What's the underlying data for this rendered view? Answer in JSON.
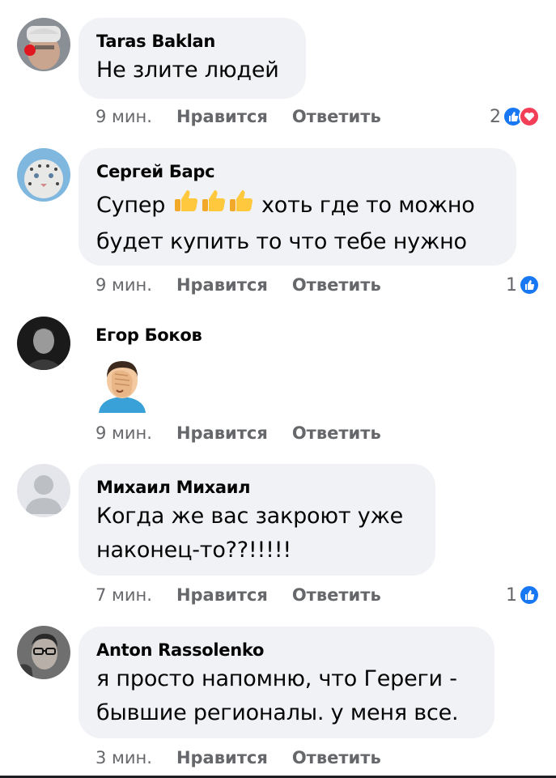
{
  "comments": [
    {
      "author": "Taras Baklan",
      "lines": [
        "Не злите людей"
      ],
      "time": "9 мин.",
      "like_label": "Нравится",
      "reply_label": "Ответить",
      "reaction_count": "2",
      "reactions": [
        "like-icon",
        "love-icon"
      ]
    },
    {
      "author": "Сергей Барс",
      "line1_before": "Супер",
      "line1_after": "хоть где то можно",
      "line2": "будет купить то что тебе нужно",
      "emoji": [
        "thumbs-up-icon",
        "thumbs-up-icon",
        "thumbs-up-icon"
      ],
      "time": "9 мин.",
      "like_label": "Нравится",
      "reply_label": "Ответить",
      "reaction_count": "1",
      "reactions": [
        "like-icon"
      ]
    },
    {
      "author": "Егор Боков",
      "emoji": "facepalm-icon",
      "time": "9 мин.",
      "like_label": "Нравится",
      "reply_label": "Ответить"
    },
    {
      "author": "Михаил Михаил",
      "lines": [
        "Когда же вас закроют уже",
        "наконец-то??!!!!!"
      ],
      "time": "7 мин.",
      "like_label": "Нравится",
      "reply_label": "Ответить",
      "reaction_count": "1",
      "reactions": [
        "like-icon"
      ]
    },
    {
      "author": "Anton Rassolenko",
      "lines": [
        "я просто напомню, что Гереги -",
        "бывшие регионалы. у меня все."
      ],
      "time": "3 мин.",
      "like_label": "Нравится",
      "reply_label": "Ответить"
    }
  ],
  "colors": {
    "bubble": "#f0f2f5",
    "meta_text": "#65676b",
    "like_blue": "#1877f2",
    "love_red": "#f33e58"
  }
}
